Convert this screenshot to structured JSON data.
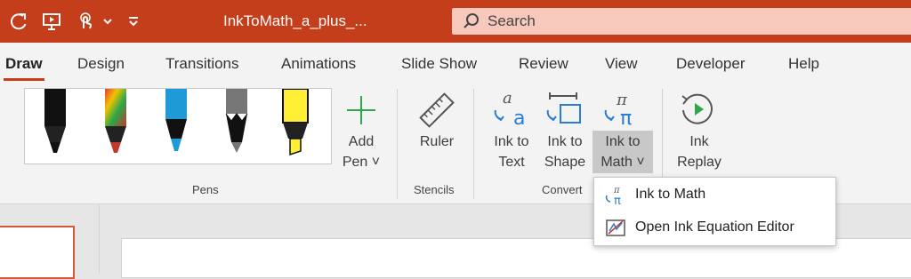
{
  "titlebar": {
    "doc_title": "InkToMath_a_plus_...",
    "search_placeholder": "Search"
  },
  "tabs": [
    {
      "label": "Draw",
      "active": true
    },
    {
      "label": "Design"
    },
    {
      "label": "Transitions"
    },
    {
      "label": "Animations"
    },
    {
      "label": "Slide Show"
    },
    {
      "label": "Review"
    },
    {
      "label": "View"
    },
    {
      "label": "Developer"
    },
    {
      "label": "Help"
    }
  ],
  "ribbon": {
    "add_pen": {
      "line1": "Add",
      "line2": "Pen ˅"
    },
    "ruler": {
      "label": "Ruler"
    },
    "ink_to_text": {
      "line1": "Ink to",
      "line2": "Text"
    },
    "ink_to_shape": {
      "line1": "Ink to",
      "line2": "Shape"
    },
    "ink_to_math": {
      "line1": "Ink to",
      "line2": "Math ˅"
    },
    "ink_replay": {
      "line1": "Ink",
      "line2": "Replay"
    },
    "groups": {
      "pens": "Pens",
      "stencils": "Stencils",
      "convert": "Convert"
    }
  },
  "dropdown": {
    "items": [
      {
        "label": "Ink to Math"
      },
      {
        "label": "Open Ink Equation Editor"
      }
    ]
  },
  "colors": {
    "accent": "#c43e1c",
    "icon_blue": "#2b7cd3",
    "pen_red": "#c0392b",
    "pen_blue": "#1e9ad6",
    "highlighter": "#ffee33"
  }
}
